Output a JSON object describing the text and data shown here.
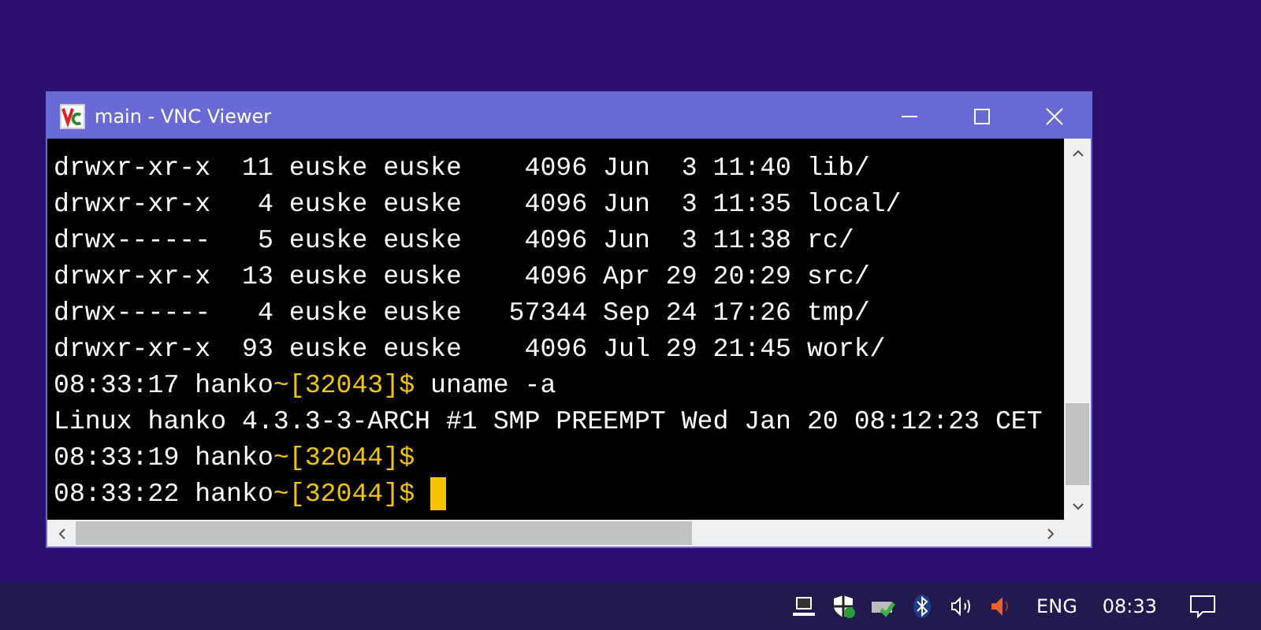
{
  "window": {
    "title": "main - VNC Viewer"
  },
  "terminal": {
    "lines": [
      {
        "segments": [
          {
            "text": "drwxr-xr-x  11 euske euske    4096 Jun  3 11:40 lib/",
            "kind": "output"
          }
        ]
      },
      {
        "segments": [
          {
            "text": "drwxr-xr-x   4 euske euske    4096 Jun  3 11:35 local/",
            "kind": "output"
          }
        ]
      },
      {
        "segments": [
          {
            "text": "drwx------   5 euske euske    4096 Jun  3 11:38 rc/",
            "kind": "output"
          }
        ]
      },
      {
        "segments": [
          {
            "text": "drwxr-xr-x  13 euske euske    4096 Apr 29 20:29 src/",
            "kind": "output"
          }
        ]
      },
      {
        "segments": [
          {
            "text": "drwx------   4 euske euske   57344 Sep 24 17:26 tmp/",
            "kind": "output"
          }
        ]
      },
      {
        "segments": [
          {
            "text": "drwxr-xr-x  93 euske euske    4096 Jul 29 21:45 work/",
            "kind": "output"
          }
        ]
      },
      {
        "segments": [
          {
            "text": "08:33:17 hanko",
            "kind": "output"
          },
          {
            "text": "~[32043]$",
            "kind": "prompt"
          },
          {
            "text": " uname -a",
            "kind": "output"
          }
        ]
      },
      {
        "segments": [
          {
            "text": "Linux hanko 4.3.3-3-ARCH #1 SMP PREEMPT Wed Jan 20 08:12:23 CET",
            "kind": "output"
          }
        ]
      },
      {
        "segments": [
          {
            "text": "08:33:19 hanko",
            "kind": "output"
          },
          {
            "text": "~[32044]$",
            "kind": "prompt"
          }
        ]
      },
      {
        "segments": [
          {
            "text": "08:33:22 hanko",
            "kind": "output"
          },
          {
            "text": "~[32044]$",
            "kind": "prompt"
          }
        ],
        "cursor": true
      }
    ]
  },
  "taskbar": {
    "language": "ENG",
    "time": "08:33"
  }
}
